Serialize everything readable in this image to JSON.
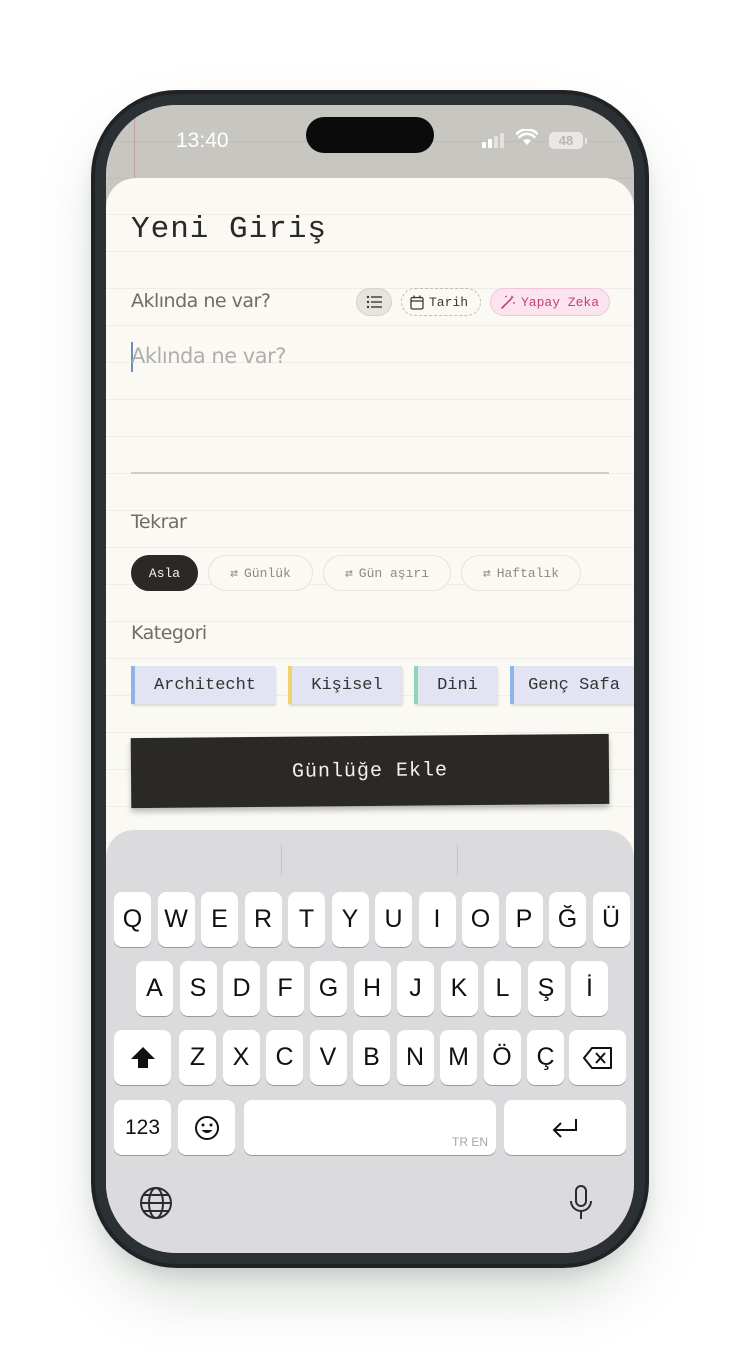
{
  "status_bar": {
    "time": "13:40",
    "battery": "48"
  },
  "sheet": {
    "title": "Yeni Giriş",
    "prompt_label": "Aklında ne var?",
    "tools": {
      "date_label": "Tarih",
      "ai_label": "Yapay Zeka"
    },
    "textarea_placeholder": "Aklında ne var?",
    "repeat_label": "Tekrar",
    "repeat_options": [
      "Asla",
      "Günlük",
      "Gün aşırı",
      "Haftalık"
    ],
    "repeat_selected": "Asla",
    "category_label": "Kategori",
    "categories": [
      {
        "name": "Architecht",
        "color": "#8fb4e8"
      },
      {
        "name": "Kişisel",
        "color": "#f0d36a"
      },
      {
        "name": "Dini",
        "color": "#8ad9b3"
      },
      {
        "name": "Genç Safa",
        "color": "#8fb4e8"
      }
    ],
    "submit_label": "Günlüğe Ekle"
  },
  "keyboard": {
    "row1": [
      "Q",
      "W",
      "E",
      "R",
      "T",
      "Y",
      "U",
      "I",
      "O",
      "P",
      "Ğ",
      "Ü"
    ],
    "row2": [
      "A",
      "S",
      "D",
      "F",
      "G",
      "H",
      "J",
      "K",
      "L",
      "Ş",
      "İ"
    ],
    "row3": [
      "Z",
      "X",
      "C",
      "V",
      "B",
      "N",
      "M",
      "Ö",
      "Ç"
    ],
    "numbers_key": "123",
    "space_hint": "TR EN",
    "icons": [
      "shift-icon",
      "backspace-icon",
      "emoji-icon",
      "return-icon",
      "globe-icon",
      "microphone-icon"
    ]
  },
  "colors": {
    "accent_dark": "#2a2926",
    "ai_pink": "#c0407a",
    "paper": "#faf9f4"
  }
}
